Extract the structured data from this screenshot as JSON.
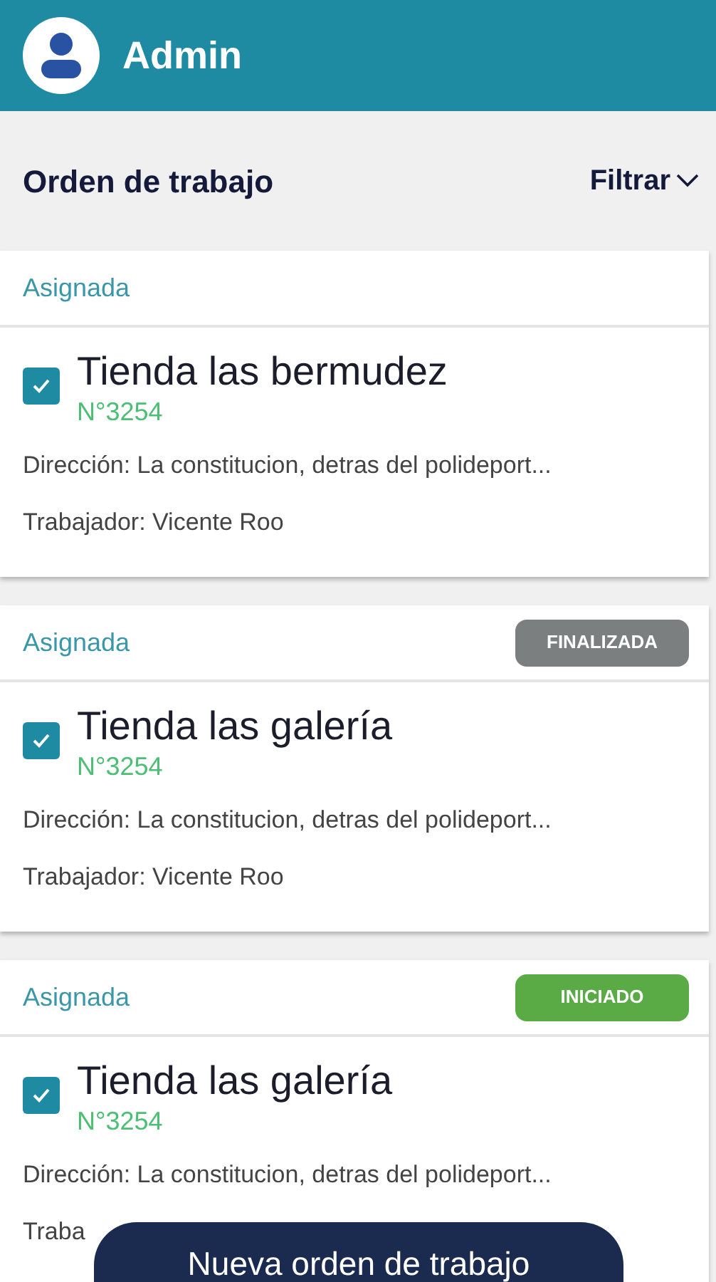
{
  "header": {
    "title": "Admin"
  },
  "toolbar": {
    "title": "Orden de trabajo",
    "filter_label": "Filtrar"
  },
  "orders": [
    {
      "status": "Asignada",
      "checked": true,
      "name": "Tienda las bermudez",
      "number": "N°3254",
      "address": "Dirección: La constitucion, detras del polideport...",
      "worker": "Trabajador: Vicente Roo"
    },
    {
      "status": "Asignada",
      "badge": {
        "label": "FINALIZADA",
        "color": "#7b7f80"
      },
      "checked": true,
      "name": "Tienda las galería",
      "number": "N°3254",
      "address": "Dirección: La constitucion, detras del polideport...",
      "worker": "Trabajador: Vicente Roo"
    },
    {
      "status": "Asignada",
      "badge": {
        "label": "INICIADO",
        "color": "#5aaa46"
      },
      "checked": true,
      "name": "Tienda las galería",
      "number": "N°3254",
      "address": "Dirección: La constitucion, detras del polideport...",
      "worker": "Traba"
    }
  ],
  "fab": {
    "label": "Nueva orden de trabajo"
  }
}
